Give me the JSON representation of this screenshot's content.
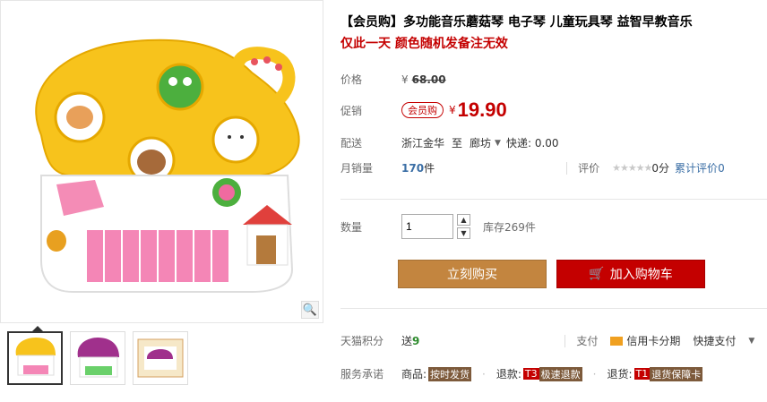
{
  "title": "【会员购】多功能音乐蘑菇琴 电子琴 儿童玩具琴 益智早教音乐",
  "subtitle": "仅此一天 颜色随机发备注无效",
  "price": {
    "label": "价格",
    "currency": "¥",
    "original": "68.00"
  },
  "promo": {
    "label": "促销",
    "tag": "会员购",
    "currency": "¥",
    "price": "19.90"
  },
  "shipping": {
    "label": "配送",
    "from": "浙江金华",
    "to_word": "至",
    "to": "廊坊",
    "fee": "快递: 0.00"
  },
  "sales": {
    "label": "月销量",
    "count": "170",
    "unit": "件",
    "review_label": "评价",
    "score": "0分",
    "total_reviews_label": "累计评价",
    "total_reviews": "0",
    "stars": "★★★★★"
  },
  "quantity": {
    "label": "数量",
    "value": "1",
    "stock": "库存269件"
  },
  "buttons": {
    "buy_now": "立刻购买",
    "add_cart": "加入购物车"
  },
  "points": {
    "label": "天猫积分",
    "prefix": "送",
    "value": "9"
  },
  "payment": {
    "label": "支付",
    "credit": "信用卡分期",
    "fast": "快捷支付"
  },
  "service": {
    "label": "服务承诺",
    "goods_label": "商品:",
    "goods_tag": "按时发货",
    "refund_label": "退款:",
    "refund_code": "T3",
    "refund_tag": "极速退款",
    "return_label": "退货:",
    "return_code": "T1",
    "return_tag": "退货保障卡"
  },
  "colors": {
    "accent": "#c40000",
    "buy": "#c3853f",
    "link": "#3a6ea5"
  }
}
